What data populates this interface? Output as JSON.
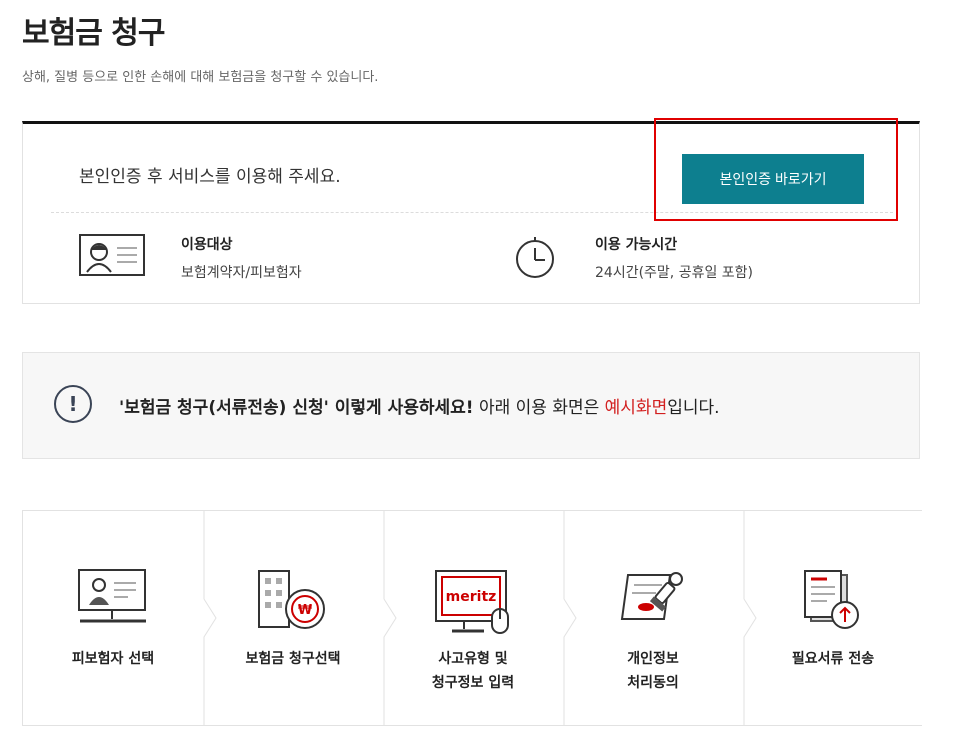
{
  "page": {
    "title": "보험금 청구",
    "subtitle": "상해, 질병 등으로 인한 손해에 대해 보험금을 청구할 수 있습니다."
  },
  "auth": {
    "message": "본인인증 후 서비스를 이용해 주세요.",
    "button_label": "본인인증 바로가기",
    "target_label": "이용대상",
    "target_value": "보험계약자/피보험자",
    "hours_label": "이용 가능시간",
    "hours_value": "24시간(주말, 공휴일 포함)"
  },
  "notice": {
    "bold_text": "'보험금 청구(서류전송) 신청' 이렇게 사용하세요!",
    "normal_text": " 아래 이용 화면은 ",
    "red_text": "예시화면",
    "end_text": "입니다."
  },
  "steps": [
    {
      "line1": "피보험자 선택",
      "line2": "",
      "icon": "person-computer-icon"
    },
    {
      "line1": "보험금 청구선택",
      "line2": "",
      "icon": "building-won-icon"
    },
    {
      "line1": "사고유형 및",
      "line2": "청구정보 입력",
      "icon": "meritz-monitor-icon"
    },
    {
      "line1": "개인정보",
      "line2": "처리동의",
      "icon": "document-stamp-icon"
    },
    {
      "line1": "필요서류 전송",
      "line2": "",
      "icon": "document-upload-icon"
    }
  ],
  "monitor_brand": "meritz",
  "colors": {
    "accent": "#0d7f8f",
    "highlight": "#e00000",
    "red_text": "#d21f1f"
  }
}
